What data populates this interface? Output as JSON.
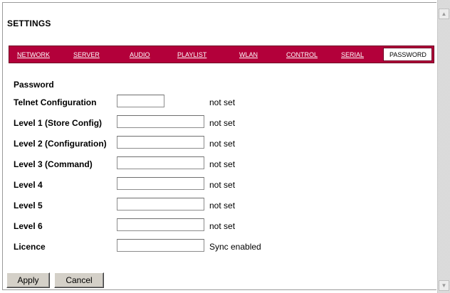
{
  "settings": {
    "title": "SETTINGS"
  },
  "tabs": [
    {
      "label": "NETWORK"
    },
    {
      "label": "SERVER"
    },
    {
      "label": "AUDIO"
    },
    {
      "label": "PLAYLIST"
    },
    {
      "label": "WLAN"
    },
    {
      "label": "CONTROL"
    },
    {
      "label": "SERIAL"
    },
    {
      "label": "PASSWORD",
      "active": true
    }
  ],
  "form": {
    "heading": "Password",
    "rows": [
      {
        "label": "Telnet Configuration",
        "value": "",
        "status": "not set"
      },
      {
        "label": "Level 1 (Store Config)",
        "value": "",
        "status": "not set"
      },
      {
        "label": "Level 2 (Configuration)",
        "value": "",
        "status": "not set"
      },
      {
        "label": "Level 3 (Command)",
        "value": "",
        "status": "not set"
      },
      {
        "label": "Level 4",
        "value": "",
        "status": "not set"
      },
      {
        "label": "Level 5",
        "value": "",
        "status": "not set"
      },
      {
        "label": "Level 6",
        "value": "",
        "status": "not set"
      },
      {
        "label": "Licence",
        "value": "",
        "status": "Sync enabled"
      }
    ]
  },
  "buttons": {
    "apply": "Apply",
    "cancel": "Cancel"
  },
  "scrollbar": {
    "up_icon": "arrow-up-icon",
    "down_icon": "arrow-down-icon"
  },
  "colors": {
    "tab_bar": "#b3003a",
    "background": "#ffffff",
    "button_face": "#d4d0c8"
  }
}
